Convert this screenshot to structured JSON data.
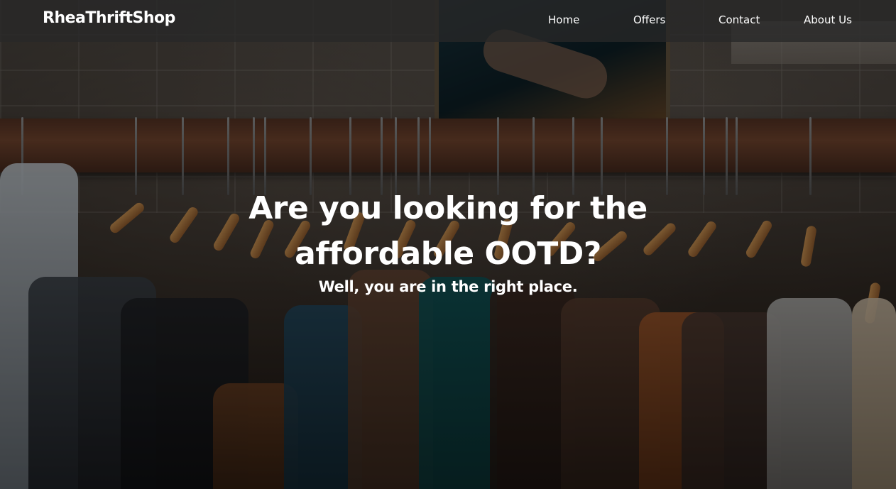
{
  "navbar": {
    "brand": "RheaThriftShop",
    "links": [
      {
        "label": "Home"
      },
      {
        "label": "Offers"
      },
      {
        "label": "Contact"
      },
      {
        "label": "About Us"
      }
    ]
  },
  "hero": {
    "title": "Are you looking for the affordable OOTD?",
    "subtitle": "Well, you are in the right place."
  },
  "colors": {
    "navbar_bg": "#282828",
    "text": "#ffffff"
  }
}
